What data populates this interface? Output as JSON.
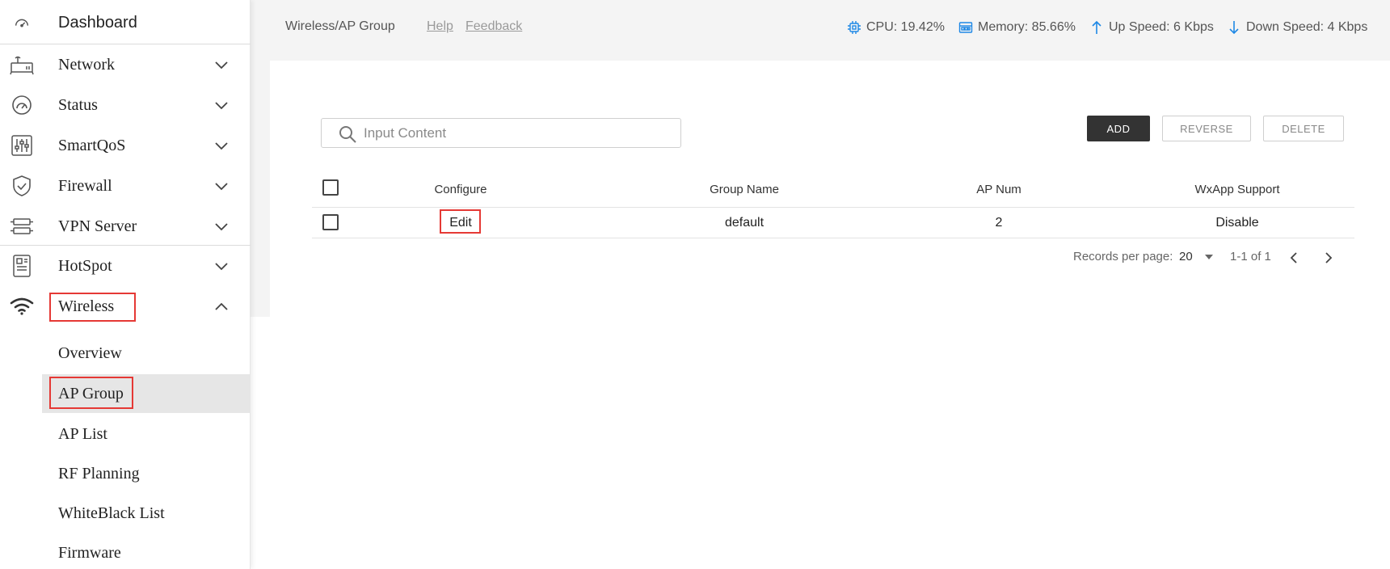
{
  "sidebar": {
    "items": [
      {
        "label": "Dashboard",
        "icon": "gauge-icon"
      },
      {
        "label": "Network",
        "icon": "router-icon"
      },
      {
        "label": "Status",
        "icon": "speedometer-icon"
      },
      {
        "label": "SmartQoS",
        "icon": "sliders-icon"
      },
      {
        "label": "Firewall",
        "icon": "shield-icon"
      },
      {
        "label": "VPN Server",
        "icon": "server-icon"
      },
      {
        "label": "HotSpot",
        "icon": "hotspot-icon"
      },
      {
        "label": "Wireless",
        "icon": "wifi-icon"
      }
    ],
    "wireless_sub": [
      {
        "label": "Overview"
      },
      {
        "label": "AP Group"
      },
      {
        "label": "AP List"
      },
      {
        "label": "RF Planning"
      },
      {
        "label": "WhiteBlack List"
      },
      {
        "label": "Firmware"
      }
    ]
  },
  "header": {
    "breadcrumb": "Wireless/AP Group",
    "help": "Help",
    "feedback": "Feedback",
    "cpu": "CPU: 19.42%",
    "memory": "Memory: 85.66%",
    "up_speed": "Up Speed: 6 Kbps",
    "down_speed": "Down Speed: 4 Kbps"
  },
  "search": {
    "placeholder": "Input Content"
  },
  "buttons": {
    "add": "ADD",
    "reverse": "REVERSE",
    "delete": "DELETE"
  },
  "table": {
    "columns": [
      "Configure",
      "Group Name",
      "AP Num",
      "WxApp Support"
    ],
    "rows": [
      {
        "configure": "Edit",
        "group_name": "default",
        "ap_num": "2",
        "wxapp_support": "Disable"
      }
    ]
  },
  "pagination": {
    "records_label": "Records per page:",
    "per_page": "20",
    "range": "1-1 of 1"
  },
  "colors": {
    "accent": "#1e88e5",
    "highlight": "#e53935",
    "primary_button": "#333333"
  }
}
